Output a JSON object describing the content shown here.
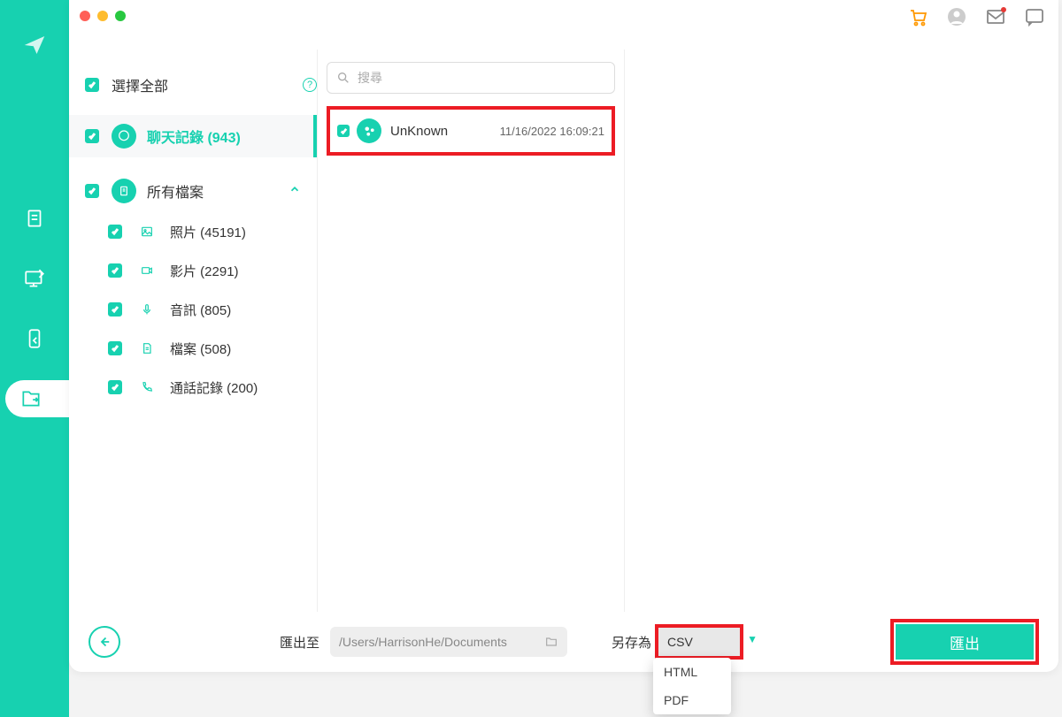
{
  "sidebar": {
    "select_all": "選擇全部",
    "chat": "聊天記錄 (943)",
    "all_files": "所有檔案",
    "items": [
      {
        "label": "照片 (45191)"
      },
      {
        "label": "影片 (2291)"
      },
      {
        "label": "音訊 (805)"
      },
      {
        "label": "檔案 (508)"
      },
      {
        "label": "通話記錄 (200)"
      }
    ]
  },
  "search": {
    "placeholder": "搜尋"
  },
  "entry": {
    "name": "UnKnown",
    "date": "11/16/2022 16:09:21"
  },
  "footer": {
    "export_to": "匯出至",
    "path": "/Users/HarrisonHe/Documents",
    "save_as": "另存為",
    "selected": "CSV",
    "options": [
      "HTML",
      "PDF"
    ],
    "export": "匯出"
  }
}
